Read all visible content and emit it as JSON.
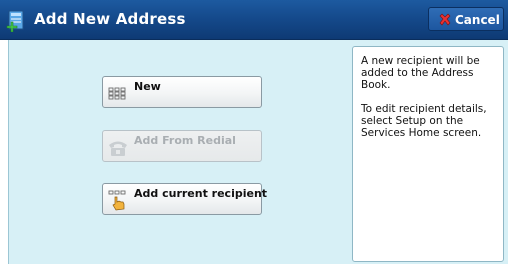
{
  "window": {
    "title": "Add New Address",
    "title_icon": "address-book-add-icon"
  },
  "cancel": {
    "label": "Cancel",
    "icon": "red-x-icon"
  },
  "options": [
    {
      "label": "New",
      "icon": "keypad-icon",
      "enabled": true
    },
    {
      "label": "Add From Redial",
      "icon": "telephone-icon",
      "enabled": false
    },
    {
      "label": "Add current recipient",
      "icon": "keypad-hand-icon",
      "enabled": true
    }
  ],
  "info": {
    "paragraph1": "A new recipient will be added to the Address Book.",
    "paragraph2": "To edit recipient details, select Setup on the Services Home screen."
  },
  "colors": {
    "titlebar": "#154a8c",
    "content_background": "#d7f0f6",
    "cancel_icon": "#e02a2a"
  }
}
